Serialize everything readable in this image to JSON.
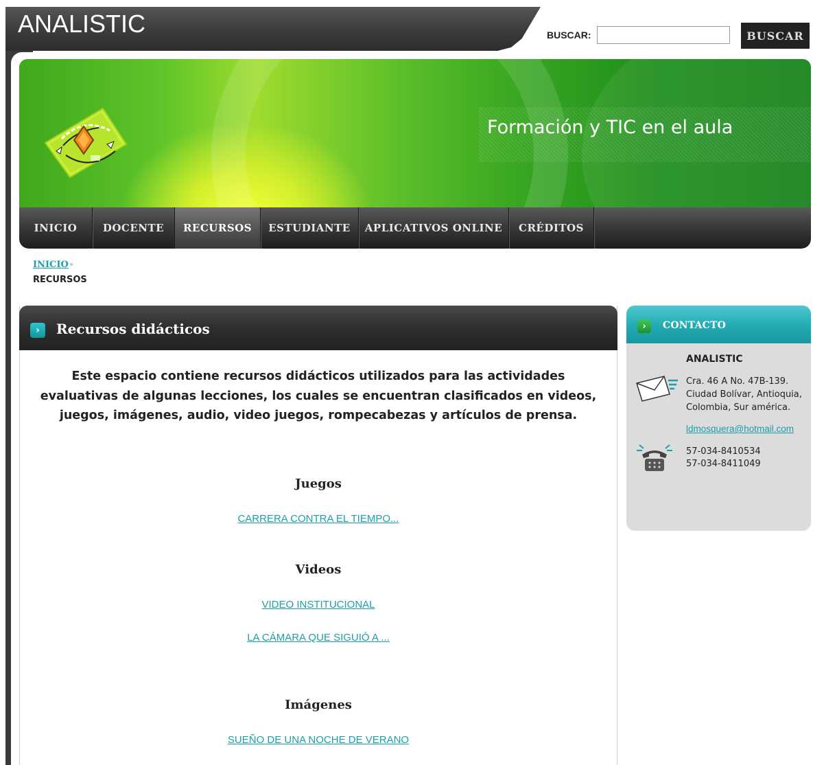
{
  "site": {
    "title": "ANALISTIC"
  },
  "search": {
    "label": "BUSCAR:",
    "value": "",
    "button": "BUSCAR"
  },
  "banner": {
    "caption": "Formación y TIC en el aula"
  },
  "nav": {
    "items": [
      {
        "label": "INICIO"
      },
      {
        "label": "DOCENTE"
      },
      {
        "label": "RECURSOS",
        "active": true
      },
      {
        "label": "ESTUDIANTE"
      },
      {
        "label": "APLICATIVOS ONLINE"
      },
      {
        "label": "CRÉDITOS"
      }
    ]
  },
  "breadcrumb": {
    "home": "INICIO",
    "separator": "»",
    "current": "RECURSOS"
  },
  "main": {
    "title": "Recursos didácticos",
    "intro": "Este espacio contiene recursos didácticos utilizados para las actividades evaluativas de algunas lecciones, los cuales se encuentran clasificados en videos, juegos, imágenes, audio, video juegos, rompecabezas y artículos de prensa.",
    "sections": [
      {
        "title": "Juegos",
        "links": [
          "CARRERA CONTRA EL TIEMPO..."
        ]
      },
      {
        "title": "Videos",
        "links": [
          "VIDEO INSTITUCIONAL",
          "LA  CÁMARA QUE SIGUIÓ A ..."
        ]
      },
      {
        "title": "Imágenes",
        "links": [
          "SUEÑO DE UNA NOCHE DE VERANO"
        ]
      }
    ]
  },
  "contact": {
    "title": "CONTACTO",
    "org": "ANALISTIC",
    "address_lines": [
      "Cra. 46 A No. 47B-139.",
      "Ciudad Bolívar, Antioquia,",
      "Colombia, Sur américa."
    ],
    "email": "ldmosquera@hotmail.com",
    "phones": [
      "57-034-8410534",
      "57-034-8411049"
    ]
  },
  "colors": {
    "accent": "#1a9fa8",
    "header_dark": "#2e2e2e",
    "banner_green": "#3aa822"
  },
  "icons": [
    "chevron-right-icon",
    "mail-icon",
    "phone-icon",
    "logo-icon"
  ]
}
